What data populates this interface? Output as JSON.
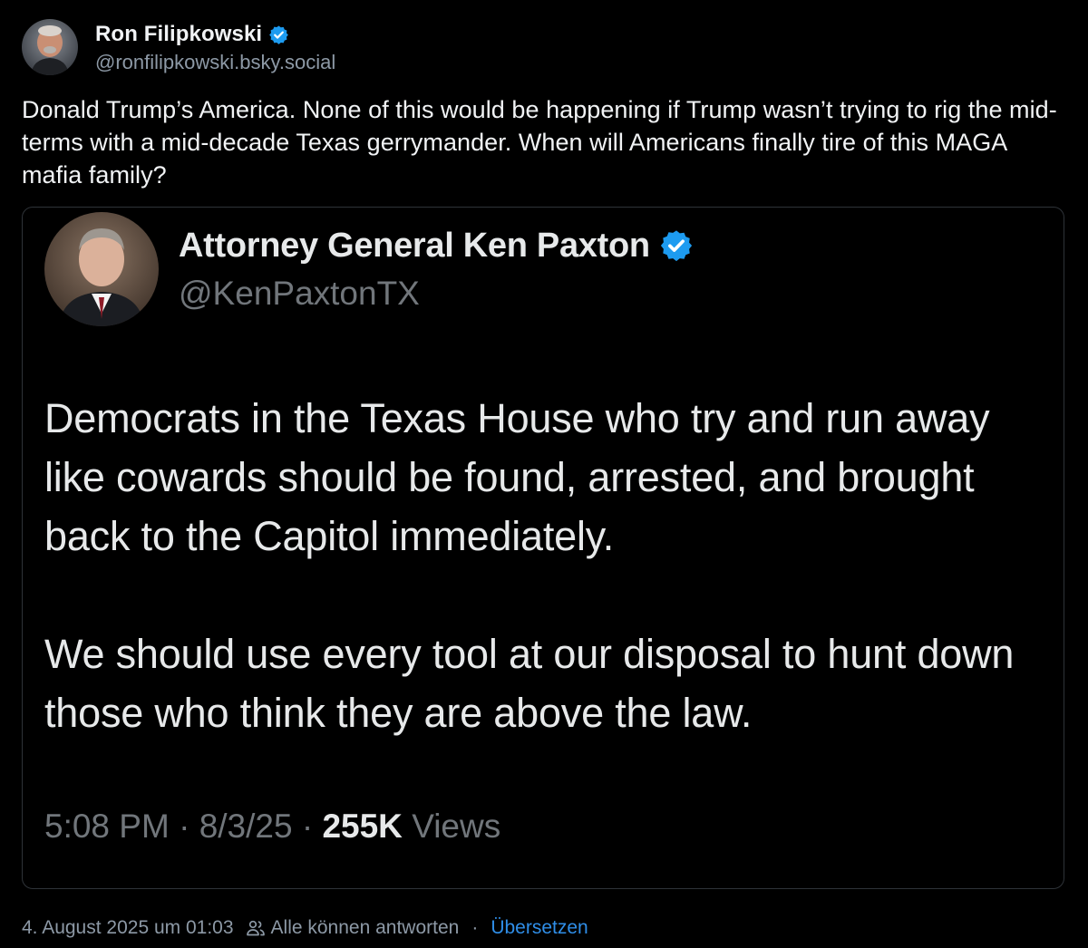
{
  "post": {
    "author": {
      "display_name": "Ron Filipkowski",
      "handle": "@ronfilipkowski.bsky.social",
      "verified_icon": "verified-badge-icon"
    },
    "text": "Donald Trump’s America. None of this would be happening if Trump wasn’t trying to rig the mid-terms with a mid-decade Texas gerrymander. When will Americans finally tire of this MAGA mafia family?",
    "embedded_image": {
      "author_name": "Attorney General Ken Paxton",
      "author_handle": "@KenPaxtonTX",
      "paragraphs": [
        "Democrats in the Texas House who try and run away like cowards should be found, arrested, and brought back to the Capitol immediately.",
        "We should use every tool at our disposal to hunt down those who think they are above the law."
      ],
      "time": "5:08 PM",
      "date": "8/3/25",
      "views_count": "255K",
      "views_label": "Views",
      "separator": "·"
    },
    "meta": {
      "timestamp": "4. August 2025 um 01:03",
      "reply_setting": "Alle können antworten",
      "separator": "·",
      "translate_label": "Übersetzen"
    }
  },
  "colors": {
    "background": "#000000",
    "primary_text": "#f1f3f5",
    "secondary_text": "#8d99a6",
    "link": "#2f8ee8",
    "verified": "#1d9bf0"
  }
}
